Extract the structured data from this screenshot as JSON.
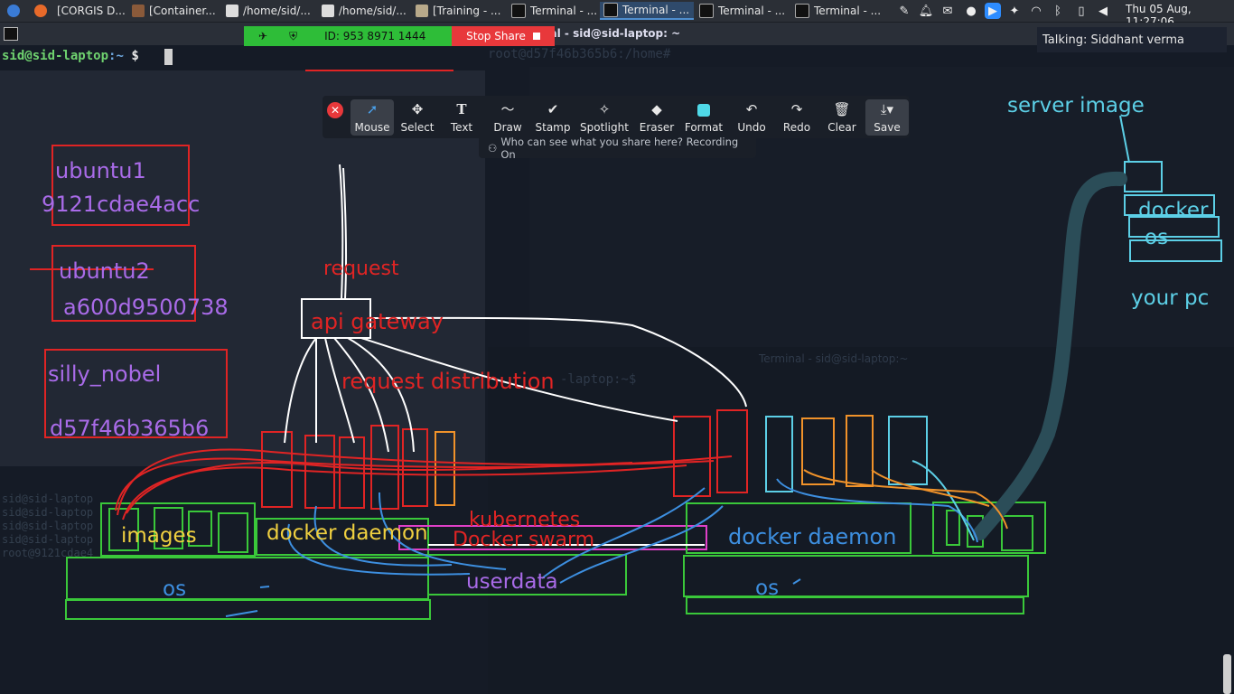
{
  "taskbar": {
    "tasks": [
      {
        "label": "[CORGIS D..."
      },
      {
        "label": "[Container..."
      },
      {
        "label": "/home/sid/..."
      },
      {
        "label": "/home/sid/..."
      },
      {
        "label": "[Training - ..."
      },
      {
        "label": "Terminal - ..."
      },
      {
        "label": "Terminal - ..."
      },
      {
        "label": "Terminal - ..."
      },
      {
        "label": "Terminal - ..."
      }
    ],
    "clock": "Thu 05 Aug, 11:27:06"
  },
  "terminal": {
    "window_title": "nal - sid@sid-laptop: ~",
    "prompt_user": "sid@sid-laptop",
    "prompt_path": ":~",
    "prompt_symbol": "$",
    "root_prompt": "root@d57f46b365b6:/home#",
    "laptop_prompt": "-laptop:~$",
    "faint_title": "Terminal - sid@sid-laptop:~",
    "ghost_lines": [
      "sid@sid-laptop",
      "sid@sid-laptop",
      "sid@sid-laptop",
      "sid@sid-laptop",
      "root@9121cdae4"
    ]
  },
  "zoom": {
    "meeting_id": "ID: 953 8971 1444",
    "stop_share": "Stop Share",
    "talking": "Talking: Siddhant verma",
    "tools": [
      {
        "label": "Mouse",
        "icon": "pointer-icon"
      },
      {
        "label": "Select",
        "icon": "move-icon"
      },
      {
        "label": "Text",
        "icon": "text-icon"
      },
      {
        "label": "Draw",
        "icon": "draw-icon"
      },
      {
        "label": "Stamp",
        "icon": "check-icon"
      },
      {
        "label": "Spotlight",
        "icon": "spotlight-icon"
      },
      {
        "label": "Eraser",
        "icon": "eraser-icon"
      },
      {
        "label": "Format",
        "icon": "format-icon"
      },
      {
        "label": "Undo",
        "icon": "undo-icon"
      },
      {
        "label": "Redo",
        "icon": "redo-icon"
      },
      {
        "label": "Clear",
        "icon": "trash-icon"
      },
      {
        "label": "Save",
        "icon": "save-icon"
      }
    ],
    "who_can_see": "Who can see what you share here? Recording On",
    "colors": {
      "share_green": "#2ebd38",
      "stop_red": "#e8383b",
      "format_cyan": "#4fd9e8"
    }
  },
  "annotations": {
    "ubuntu1": "ubuntu1",
    "ubuntu1_id": "9121cdae4acc",
    "ubuntu2": "ubuntu2",
    "ubuntu2_id": "a600d9500738",
    "silly": "silly_nobel",
    "silly_id": "d57f46b365b6",
    "request": "request",
    "api_gateway": "api gateway",
    "request_distribution": "request distribution",
    "images": "images",
    "docker_daemon_left": "docker daemon",
    "kubernetes": "kubernetes",
    "docker_swarm": "Docker swarm",
    "userdata": "userdata",
    "os_left": "os",
    "docker_daemon_right": "docker daemon",
    "os_right": "os",
    "server_image": "server image",
    "docker_small": "docker",
    "os_small": "os",
    "your_pc": "your pc",
    "colors": {
      "red": "#e02424",
      "purple": "#a96be8",
      "blue": "#3d8fe0",
      "green": "#3ac83a",
      "yellow": "#f0d040",
      "cyan": "#5ccfe6",
      "orange": "#f0922a",
      "pink": "#e040c8"
    }
  }
}
